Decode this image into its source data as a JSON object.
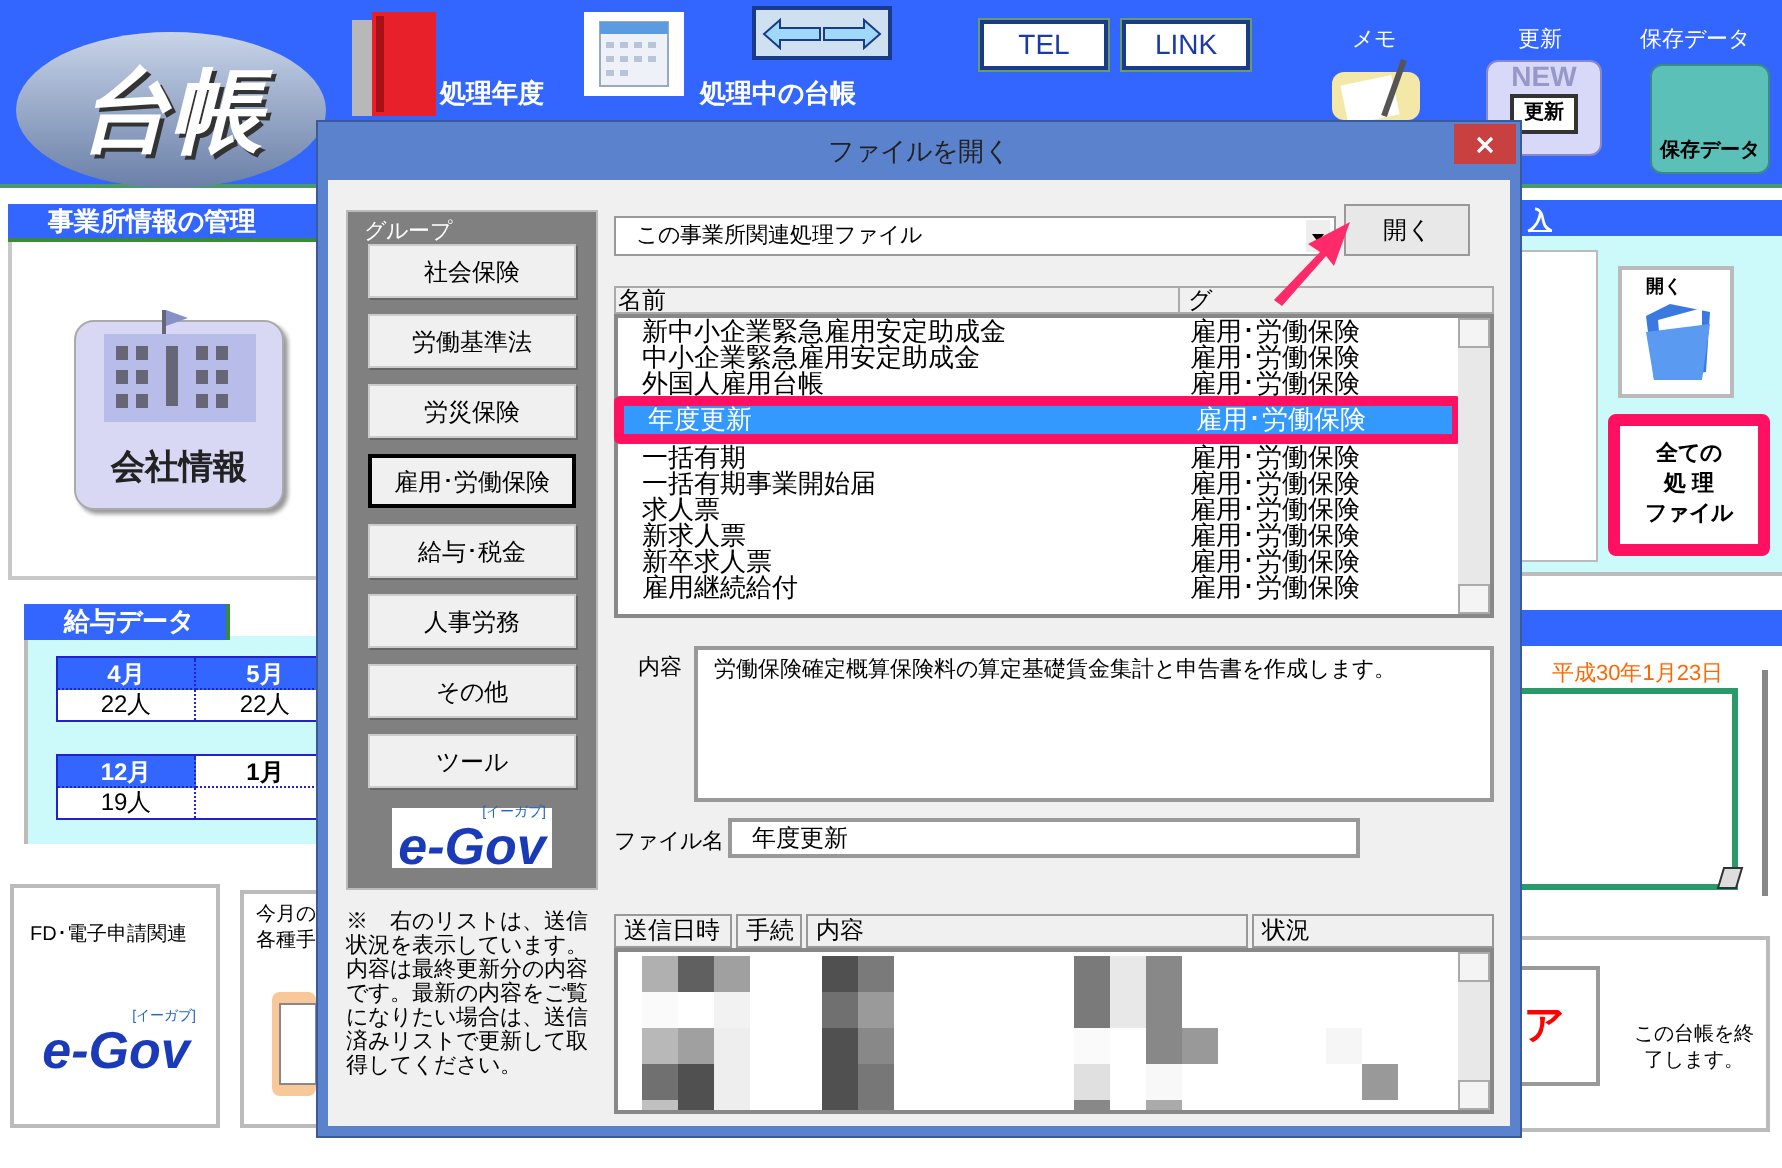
{
  "app": {
    "logo": "台帳",
    "toolbar": [
      "処理年度",
      "処理中の台帳"
    ],
    "nav_buttons": [
      "TEL",
      "LINK"
    ],
    "shortcuts": [
      {
        "kind": "memo",
        "label": "メモ"
      },
      {
        "kind": "update",
        "label": "更新",
        "badge": "NEW",
        "icon_text": "更新"
      },
      {
        "kind": "save",
        "label": "保存データ",
        "icon_text": "保存データ"
      }
    ]
  },
  "office_panel": {
    "title": "事業所情報の管理",
    "company_button": "会社情報"
  },
  "salary_panel": {
    "title": "給与データ",
    "month_rows": [
      [
        {
          "month": "4月",
          "count": "22人",
          "selected": false
        },
        {
          "month": "5月",
          "count": "22人",
          "selected": false
        }
      ],
      [
        {
          "month": "12月",
          "count": "19人",
          "selected": false
        },
        {
          "month": "1月",
          "selected": true
        }
      ]
    ]
  },
  "efiling_panel": {
    "title": "FD･電子申請関連",
    "logo": "e-Gov",
    "logo_sub": "[イーガブ]"
  },
  "monthly_panel": {
    "lines": [
      "今月の",
      "各種手"
    ]
  },
  "import_panel": {
    "title": "入",
    "open_button": "開く",
    "all_files_button": [
      "全ての",
      "処 理",
      "ファイル"
    ]
  },
  "memo_panel": {
    "date": "平成30年1月23日"
  },
  "exit_panel": {
    "button_text": "ア",
    "text": "この台帳を終了します。"
  },
  "dialog": {
    "title": "ファイルを開く",
    "group_label": "グループ",
    "groups": [
      {
        "label": "社会保険",
        "selected": false
      },
      {
        "label": "労働基準法",
        "selected": false
      },
      {
        "label": "労災保険",
        "selected": false
      },
      {
        "label": "雇用･労働保険",
        "selected": true
      },
      {
        "label": "給与･税金",
        "selected": false
      },
      {
        "label": "人事労務",
        "selected": false
      },
      {
        "label": "その他",
        "selected": false
      },
      {
        "label": "ツール",
        "selected": false
      }
    ],
    "logo": "e-Gov",
    "logo_sub": "[イーガブ]",
    "note": "※　右のリストは、送信状況を表示しています。内容は最終更新分の内容です。最新の内容をご覧になりたい場合は、送信済みリストで更新して取得してください。",
    "file_filter": "この事業所関連処理ファイル",
    "open_button": "開く",
    "list": {
      "columns": [
        "名前",
        "グ"
      ],
      "rows": [
        {
          "name": "新中小企業緊急雇用安定助成金",
          "group": "雇用･労働保険",
          "selected": false
        },
        {
          "name": "中小企業緊急雇用安定助成金",
          "group": "雇用･労働保険",
          "selected": false
        },
        {
          "name": "外国人雇用台帳",
          "group": "雇用･労働保険",
          "selected": false
        },
        {
          "name": "年度更新",
          "group": "雇用･労働保険",
          "selected": true
        },
        {
          "name": "一括有期",
          "group": "雇用･労働保険",
          "selected": false
        },
        {
          "name": "一括有期事業開始届",
          "group": "雇用･労働保険",
          "selected": false
        },
        {
          "name": "求人票",
          "group": "雇用･労働保険",
          "selected": false
        },
        {
          "name": "新求人票",
          "group": "雇用･労働保険",
          "selected": false
        },
        {
          "name": "新卒求人票",
          "group": "雇用･労働保険",
          "selected": false
        },
        {
          "name": "雇用継続給付",
          "group": "雇用･労働保険",
          "selected": false
        }
      ]
    },
    "description_label": "内容",
    "description": "労働保険確定概算保険料の算定基礎賃金集計と申告書を作成します。",
    "filename_label": "ファイル名",
    "filename": "年度更新",
    "log": {
      "columns": [
        "送信日時",
        "手続",
        "内容",
        "状況"
      ]
    }
  }
}
